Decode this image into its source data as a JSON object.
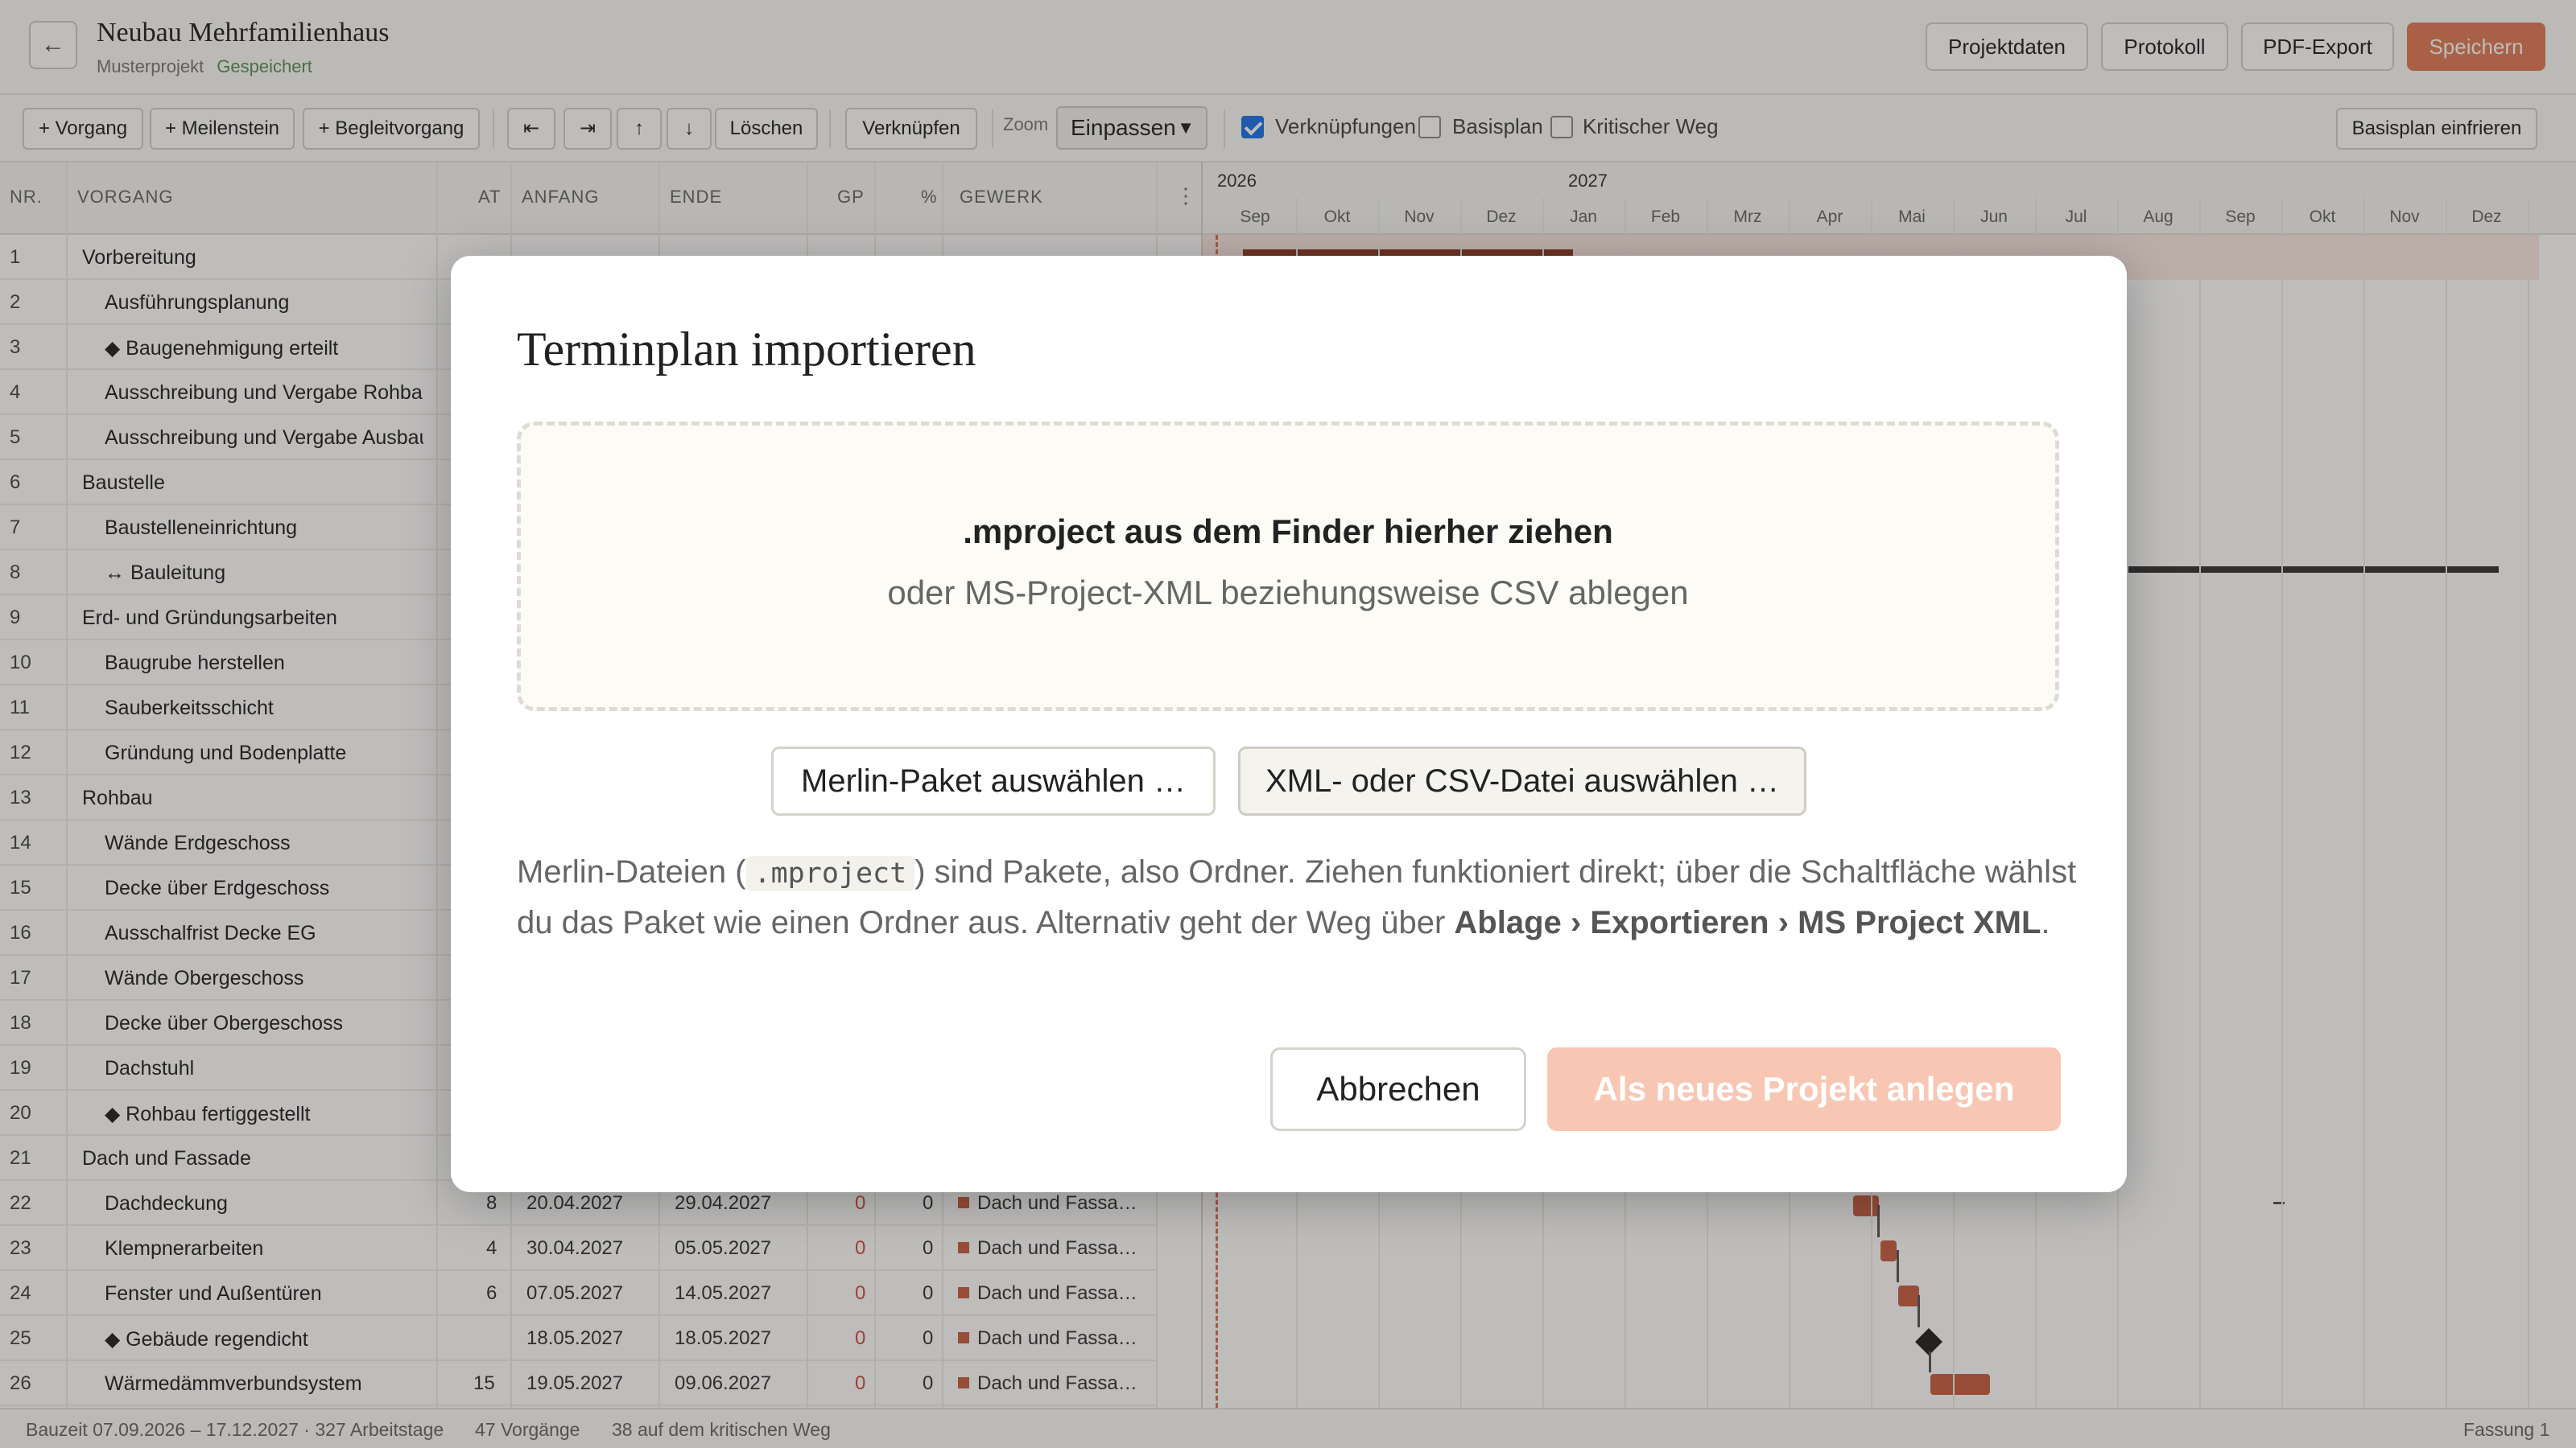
{
  "header": {
    "back_icon": "←",
    "title": "Neubau Mehrfamilienhaus",
    "subtitle": "Musterprojekt",
    "save_status": "Gespeichert",
    "buttons": {
      "projektdaten": "Projektdaten",
      "protokoll": "Protokoll",
      "pdf_export": "PDF-Export",
      "speichern": "Speichern"
    },
    "accent_color": "#e07b57"
  },
  "toolbar": {
    "add_vorgang": "+ Vorgang",
    "add_meilenstein": "+ Meilenstein",
    "add_begleitvorgang": "+ Begleitvorgang",
    "outdent_icon": "⇤",
    "indent_icon": "⇥",
    "move_up_icon": "↑",
    "move_down_icon": "↓",
    "loeschen": "Löschen",
    "verknuepfen": "Verknüpfen",
    "zoom_label": "Zoom",
    "zoom_value": "Einpassen",
    "checkboxes": {
      "verknuepfungen": {
        "label": "Verknüpfungen",
        "checked": true
      },
      "basisplan": {
        "label": "Basisplan",
        "checked": false
      },
      "kritischer_weg": {
        "label": "Kritischer Weg",
        "checked": false
      }
    },
    "basisplan_einfrieren": "Basisplan einfrieren"
  },
  "table": {
    "columns": {
      "nr": "NR.",
      "vorgang": "VORGANG",
      "at": "AT",
      "anfang": "ANFANG",
      "ende": "ENDE",
      "gp": "GP",
      "pct": "%",
      "gewerk": "GEWERK"
    },
    "menu_icon": "⋮",
    "rows": [
      {
        "nr": "1",
        "name": "Vorbereitung",
        "level": 1
      },
      {
        "nr": "2",
        "name": "Ausführungsplanung",
        "level": 2
      },
      {
        "nr": "3",
        "name": "◆ Baugenehmigung erteilt",
        "level": 2
      },
      {
        "nr": "4",
        "name": "Ausschreibung und Vergabe Rohbau",
        "level": 2
      },
      {
        "nr": "5",
        "name": "Ausschreibung und Vergabe Ausbau",
        "level": 2
      },
      {
        "nr": "6",
        "name": "Baustelle",
        "level": 1
      },
      {
        "nr": "7",
        "name": "Baustelleneinrichtung",
        "level": 2
      },
      {
        "nr": "8",
        "name": "↔ Bauleitung",
        "level": 2
      },
      {
        "nr": "9",
        "name": "Erd- und Gründungsarbeiten",
        "level": 1
      },
      {
        "nr": "10",
        "name": "Baugrube herstellen",
        "level": 2
      },
      {
        "nr": "11",
        "name": "Sauberkeitsschicht",
        "level": 2
      },
      {
        "nr": "12",
        "name": "Gründung und Bodenplatte",
        "level": 2
      },
      {
        "nr": "13",
        "name": "Rohbau",
        "level": 1
      },
      {
        "nr": "14",
        "name": "Wände Erdgeschoss",
        "level": 2
      },
      {
        "nr": "15",
        "name": "Decke über Erdgeschoss",
        "level": 2
      },
      {
        "nr": "16",
        "name": "Ausschalfrist Decke EG",
        "level": 2
      },
      {
        "nr": "17",
        "name": "Wände Obergeschoss",
        "level": 2
      },
      {
        "nr": "18",
        "name": "Decke über Obergeschoss",
        "level": 2
      },
      {
        "nr": "19",
        "name": "Dachstuhl",
        "level": 2
      },
      {
        "nr": "20",
        "name": "◆ Rohbau fertiggestellt",
        "level": 2
      },
      {
        "nr": "21",
        "name": "Dach und Fassade",
        "level": 1
      },
      {
        "nr": "22",
        "name": "Dachdeckung",
        "level": 2,
        "at": "8",
        "anfang": "20.04.2027",
        "ende": "29.04.2027",
        "gp": "0",
        "pct": "0",
        "gewerk": "Dach und Fassa…"
      },
      {
        "nr": "23",
        "name": "Klempnerarbeiten",
        "level": 2,
        "at": "4",
        "anfang": "30.04.2027",
        "ende": "05.05.2027",
        "gp": "0",
        "pct": "0",
        "gewerk": "Dach und Fassa…"
      },
      {
        "nr": "24",
        "name": "Fenster und Außentüren",
        "level": 2,
        "at": "6",
        "anfang": "07.05.2027",
        "ende": "14.05.2027",
        "gp": "0",
        "pct": "0",
        "gewerk": "Dach und Fassa…"
      },
      {
        "nr": "25",
        "name": "◆ Gebäude regendicht",
        "level": 2,
        "at": "",
        "anfang": "18.05.2027",
        "ende": "18.05.2027",
        "gp": "0",
        "pct": "0",
        "gewerk": "Dach und Fassa…"
      },
      {
        "nr": "26",
        "name": "Wärmedämmverbundsystem",
        "level": 2,
        "at": "15",
        "anfang": "19.05.2027",
        "ende": "09.06.2027",
        "gp": "0",
        "pct": "0",
        "gewerk": "Dach und Fassa…"
      }
    ],
    "gewerk_color": "#c95f42",
    "gp_color": "#d64b3a"
  },
  "gantt": {
    "years": [
      "2026",
      "2027"
    ],
    "months": [
      "Sep",
      "Okt",
      "Nov",
      "Dez",
      "Jan",
      "Feb",
      "Mrz",
      "Apr",
      "Mai",
      "Jun",
      "Jul",
      "Aug",
      "Sep",
      "Okt",
      "Nov",
      "Dez"
    ],
    "bar_color": "#c95f42"
  },
  "statusbar": {
    "bauzeit": "Bauzeit 07.09.2026 – 17.12.2027 · 327 Arbeitstage",
    "vorgaenge": "47 Vorgänge",
    "kritisch": "38 auf dem kritischen Weg",
    "fassung": "Fassung 1"
  },
  "modal": {
    "title": "Terminplan importieren",
    "drop_main": ".mproject aus dem Finder hierher ziehen",
    "drop_sub": "oder MS-Project-XML beziehungsweise CSV ablegen",
    "btn_merlin": "Merlin-Paket auswählen …",
    "btn_xml": "XML- oder CSV-Datei auswählen …",
    "help_1": "Merlin-Dateien (",
    "help_code": ".mproject",
    "help_2": ") sind Pakete, also Ordner. Ziehen funktioniert direkt; über die Schaltfläche wählst du das Paket wie einen Ordner aus. Alternativ geht der Weg über ",
    "help_bold": "Ablage › Exportieren › MS Project XML",
    "help_3": ".",
    "cancel": "Abbrechen",
    "create": "Als neues Projekt anlegen",
    "create_color": "#f8c7b4"
  }
}
